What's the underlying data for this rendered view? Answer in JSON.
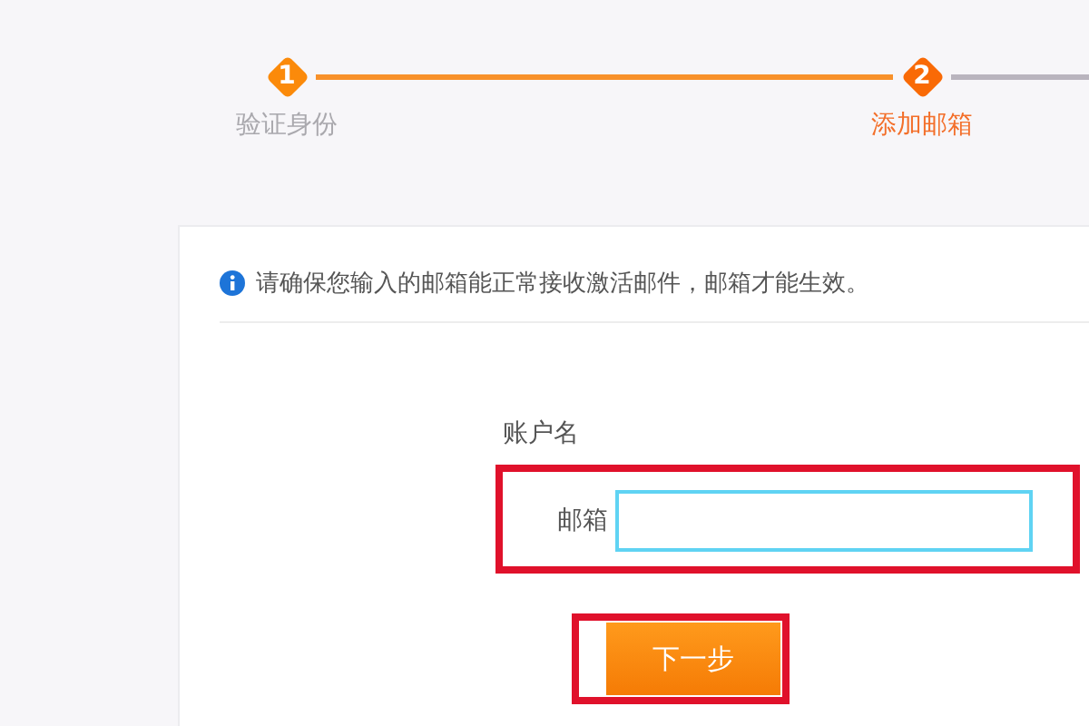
{
  "steps": [
    {
      "number": "1",
      "label": "验证身份",
      "done": true,
      "selected": false
    },
    {
      "number": "2",
      "label": "添加邮箱",
      "done": false,
      "selected": true
    }
  ],
  "more_steps": true,
  "notice": {
    "text": "请确保您输入的邮箱能正常接收激活邮件，邮箱才能生效。"
  },
  "form": {
    "heading": "账户名",
    "field": {
      "label": "邮箱",
      "highlighted": true
    },
    "button": {
      "label": "下一步",
      "highlighted": true
    }
  }
}
